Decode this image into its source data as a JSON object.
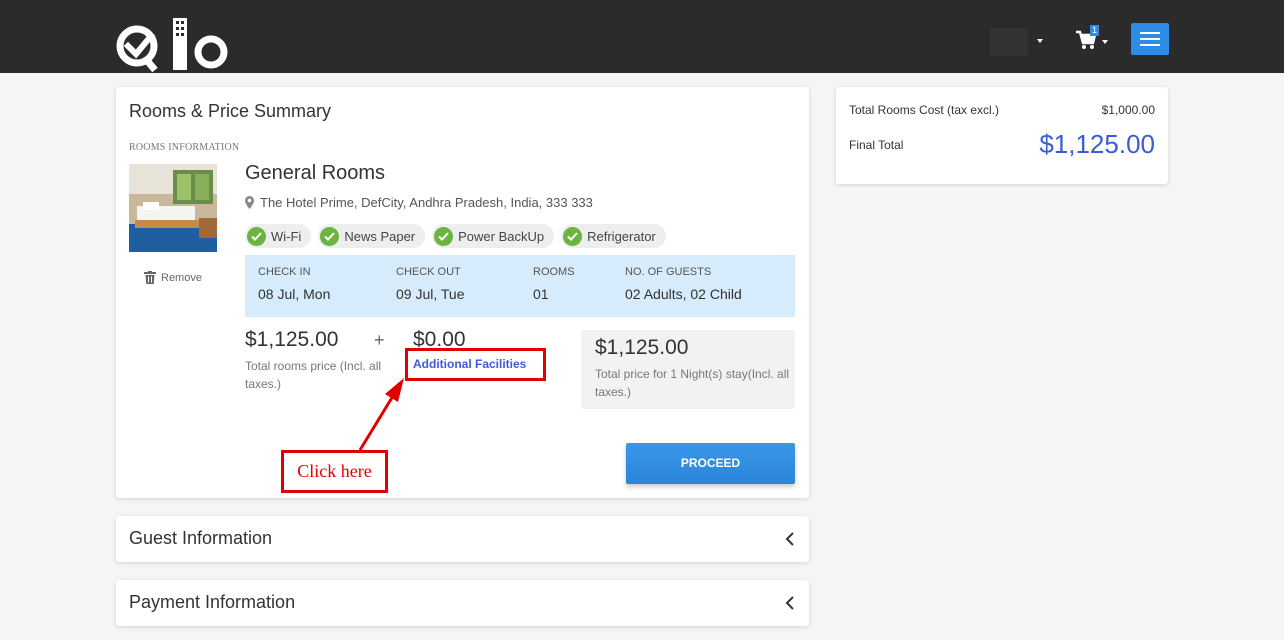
{
  "header": {
    "logo_alt": "Qlo",
    "cart_count": "1",
    "user_icon": "user-avatar",
    "cart_icon": "cart-icon",
    "menu_icon": "hamburger-icon"
  },
  "summary": {
    "title": "Rooms & Price Summary",
    "section_label": "ROOMS INFORMATION",
    "remove_label": "Remove",
    "room_name": "General Rooms",
    "address": "The Hotel Prime, DefCity, Andhra Pradesh, India, 333 333",
    "amenities": [
      "Wi-Fi",
      "News Paper",
      "Power BackUp",
      "Refrigerator"
    ],
    "booking": {
      "checkin_label": "CHECK IN",
      "checkin_value": "08 Jul, Mon",
      "checkout_label": "CHECK OUT",
      "checkout_value": "09 Jul, Tue",
      "rooms_label": "ROOMS",
      "rooms_value": "01",
      "guests_label": "NO. OF GUESTS",
      "guests_value": "02 Adults, 02 Child"
    },
    "rooms_price": "$1,125.00",
    "rooms_price_note": "Total rooms price (Incl. all taxes.)",
    "plus": "+",
    "facilities_price": "$0.00",
    "facilities_link": "Additional Facilities",
    "total_price": "$1,125.00",
    "total_price_note": "Total price for 1 Night(s) stay(Incl. all taxes.)",
    "proceed_label": "PROCEED"
  },
  "annotation": {
    "text": "Click here",
    "color": "#e00000"
  },
  "totals": {
    "rooms_cost_label": "Total Rooms Cost (tax excl.)",
    "rooms_cost_value": "$1,000.00",
    "final_label": "Final Total",
    "final_value": "$1,125.00"
  },
  "guest_section": {
    "title": "Guest Information"
  },
  "payment_section": {
    "title": "Payment Information"
  },
  "colors": {
    "header_bg": "#2b2b2b",
    "accent_blue": "#2d8ce8",
    "link_blue": "#3b5bd9",
    "check_green": "#6cb33f",
    "info_band": "#d6ebfb"
  }
}
